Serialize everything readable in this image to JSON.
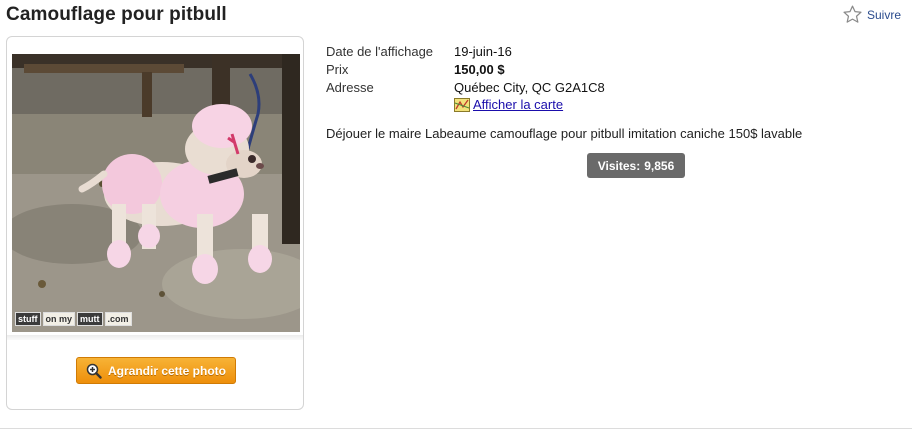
{
  "listing": {
    "title": "Camouflage pour pitbull",
    "follow_label": "Suivre",
    "enlarge_label": "Agrandir cette photo",
    "watermark": [
      "stuff",
      "on my",
      "mutt",
      ".com"
    ],
    "details": {
      "date_label": "Date de l'affichage",
      "date_value": "19-juin-16",
      "price_label": "Prix",
      "price_value": "150,00 $",
      "address_label": "Adresse",
      "address_value": "Québec City, QC G2A1C8",
      "map_link": "Afficher la carte"
    },
    "description": "Déjouer le maire Labeaume camouflage pour pitbull imitation caniche 150$ lavable",
    "visits_label": "Visites:",
    "visits_value": "9,856"
  },
  "icons": {
    "follow": "star-outline-icon",
    "enlarge": "magnifier-plus-icon",
    "map": "map-icon"
  },
  "colors": {
    "button_orange": "#f0a020",
    "link_blue": "#1a0dab",
    "follow_blue": "#2a4b8d",
    "visits_badge": "#6a6a6a"
  }
}
